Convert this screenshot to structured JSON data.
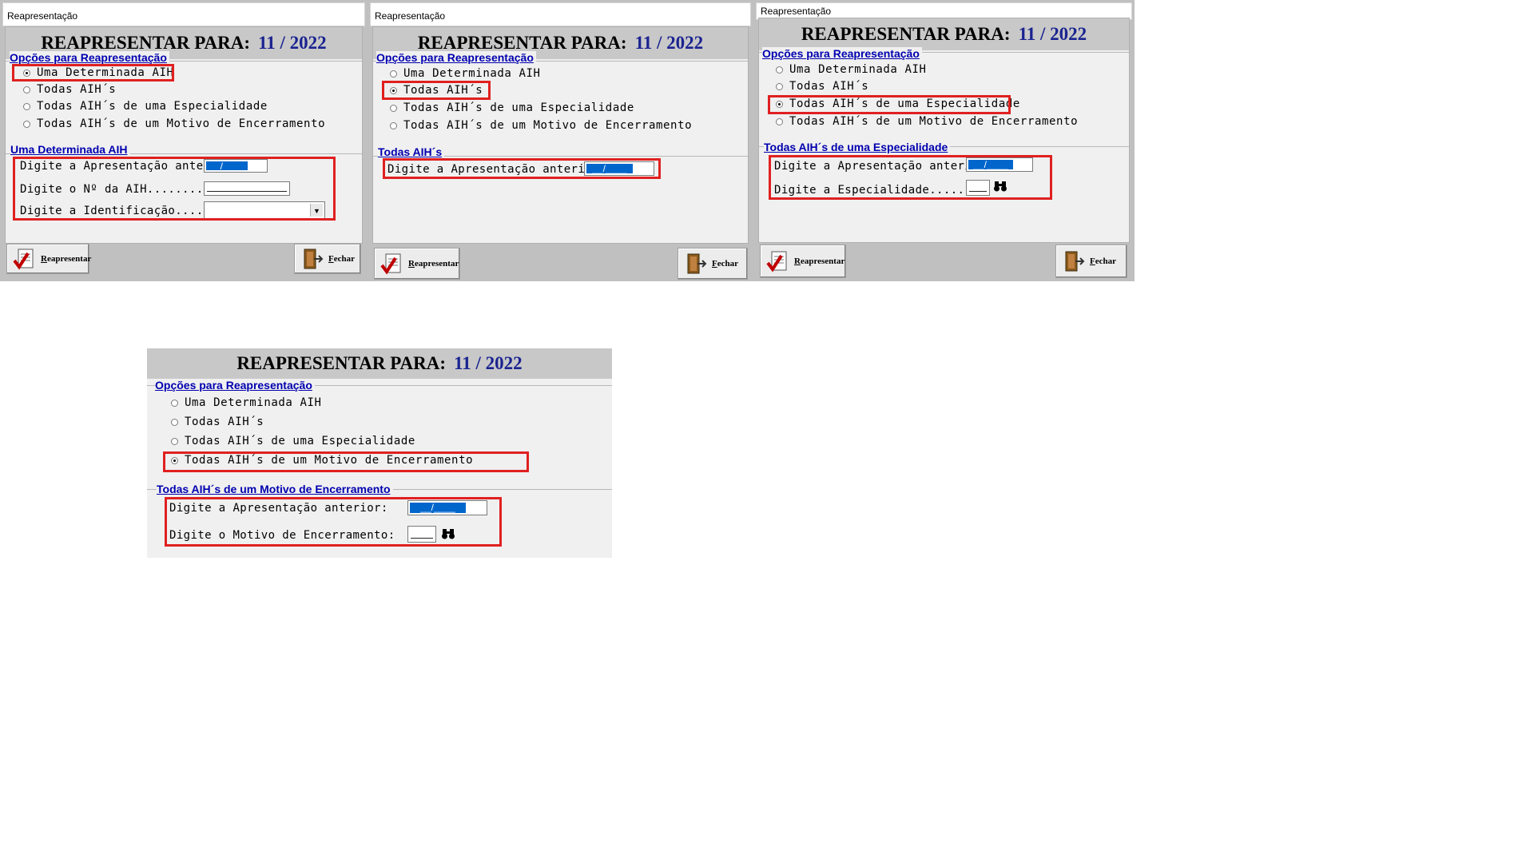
{
  "window_title": "Reapresentação",
  "header": {
    "label": "REAPRESENTAR PARA:",
    "period": "11 / 2022"
  },
  "options_group": {
    "label": "Opções para Reapresentação"
  },
  "options": [
    "Uma Determinada AIH",
    "Todas AIH´s",
    "Todas AIH´s de uma Especialidade",
    "Todas AIH´s de um Motivo de Encerramento"
  ],
  "panels": [
    {
      "section_title": "Uma Determinada AIH",
      "selected_option": 0,
      "fields": {
        "apresentacao": "Digite a Apresentação anterior:",
        "numero_aih": "Digite o Nº da AIH...........:",
        "identificacao": "Digite a Identificação........:"
      }
    },
    {
      "section_title": "Todas AIH´s",
      "selected_option": 1,
      "fields": {
        "apresentacao": "Digite a Apresentação anterior:"
      }
    },
    {
      "section_title": "Todas AIH´s de uma Especialidade",
      "selected_option": 2,
      "fields": {
        "apresentacao": "Digite a Apresentação anterior:",
        "especialidade": "Digite a Especialidade........:"
      }
    },
    {
      "section_title": "Todas AIH´s de um Motivo de Encerramento",
      "selected_option": 3,
      "fields": {
        "apresentacao": "Digite a Apresentação anterior:",
        "motivo": "Digite o Motivo de Encerramento:"
      }
    }
  ],
  "date_mask": "__/____",
  "buttons": {
    "reapresentar": "Reapresentar",
    "fechar": "Fechar"
  },
  "icons": {
    "reapresentar": "checklist-icon",
    "fechar": "exit-door-icon",
    "search": "binoculars-icon"
  },
  "colors": {
    "header_period": "#1a2390",
    "section_label": "#0000b0",
    "highlight": "#e02020",
    "mask_fill": "#0066cc"
  }
}
